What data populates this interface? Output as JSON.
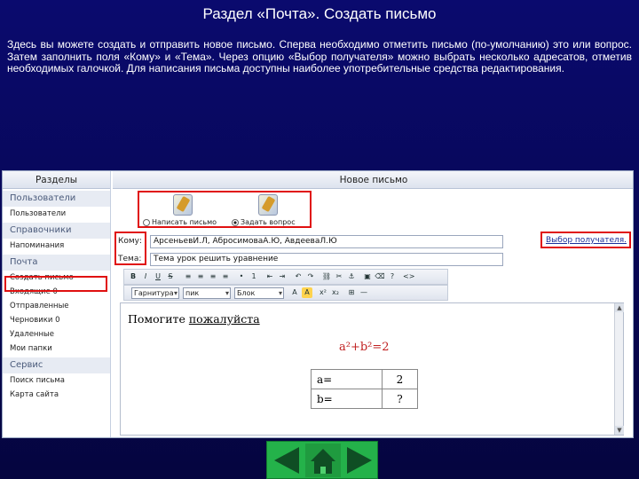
{
  "slide": {
    "title": "Раздел «Почта». Создать письмо",
    "description": "Здесь вы можете создать и отправить новое письмо. Сперва необходимо отметить письмо (по-умолчанию) это или вопрос. Затем заполнить поля «Кому» и «Тема». Через опцию «Выбор получателя» можно выбрать несколько адресатов, отметив необходимых галочкой. Для написания письма доступны наиболее употребительные средства редактирования."
  },
  "sidebar": {
    "header": "Разделы",
    "sections": [
      {
        "title": "Пользователи",
        "items": [
          "Пользователи"
        ]
      },
      {
        "title": "Справочники",
        "items": [
          "Напоминания"
        ]
      },
      {
        "title": "Почта",
        "items": [
          "Создать письмо",
          "Входящие 0",
          "Отправленные",
          "Черновики 0",
          "Удаленные",
          "Мои папки"
        ]
      },
      {
        "title": "Сервис",
        "items": [
          "Поиск письма",
          "Карта сайта"
        ]
      }
    ]
  },
  "compose": {
    "header": "Новое письмо",
    "mode_letter": "Написать письмо",
    "mode_question": "Задать вопрос",
    "to_label": "Кому:",
    "to_value": "АрсеньевИ.Л, АбросимоваА.Ю, АвдееваЛ.Ю",
    "subject_label": "Тема:",
    "subject_value": "Тема урок решить уравнение",
    "recipient_link": "Выбор получателя.",
    "font_name": "Гарнитура",
    "font_size": "пик",
    "style_select": "Блок",
    "body_text_plain": "Помогите ",
    "body_text_underlined": "пожалуйста",
    "formula": "a²+b²=2",
    "table": [
      [
        "a=",
        "2"
      ],
      [
        "b=",
        "?"
      ]
    ]
  },
  "colors": {
    "slide_background": "#0a0a6e",
    "highlight": "#e01010",
    "nav_green": "#24b24a"
  }
}
